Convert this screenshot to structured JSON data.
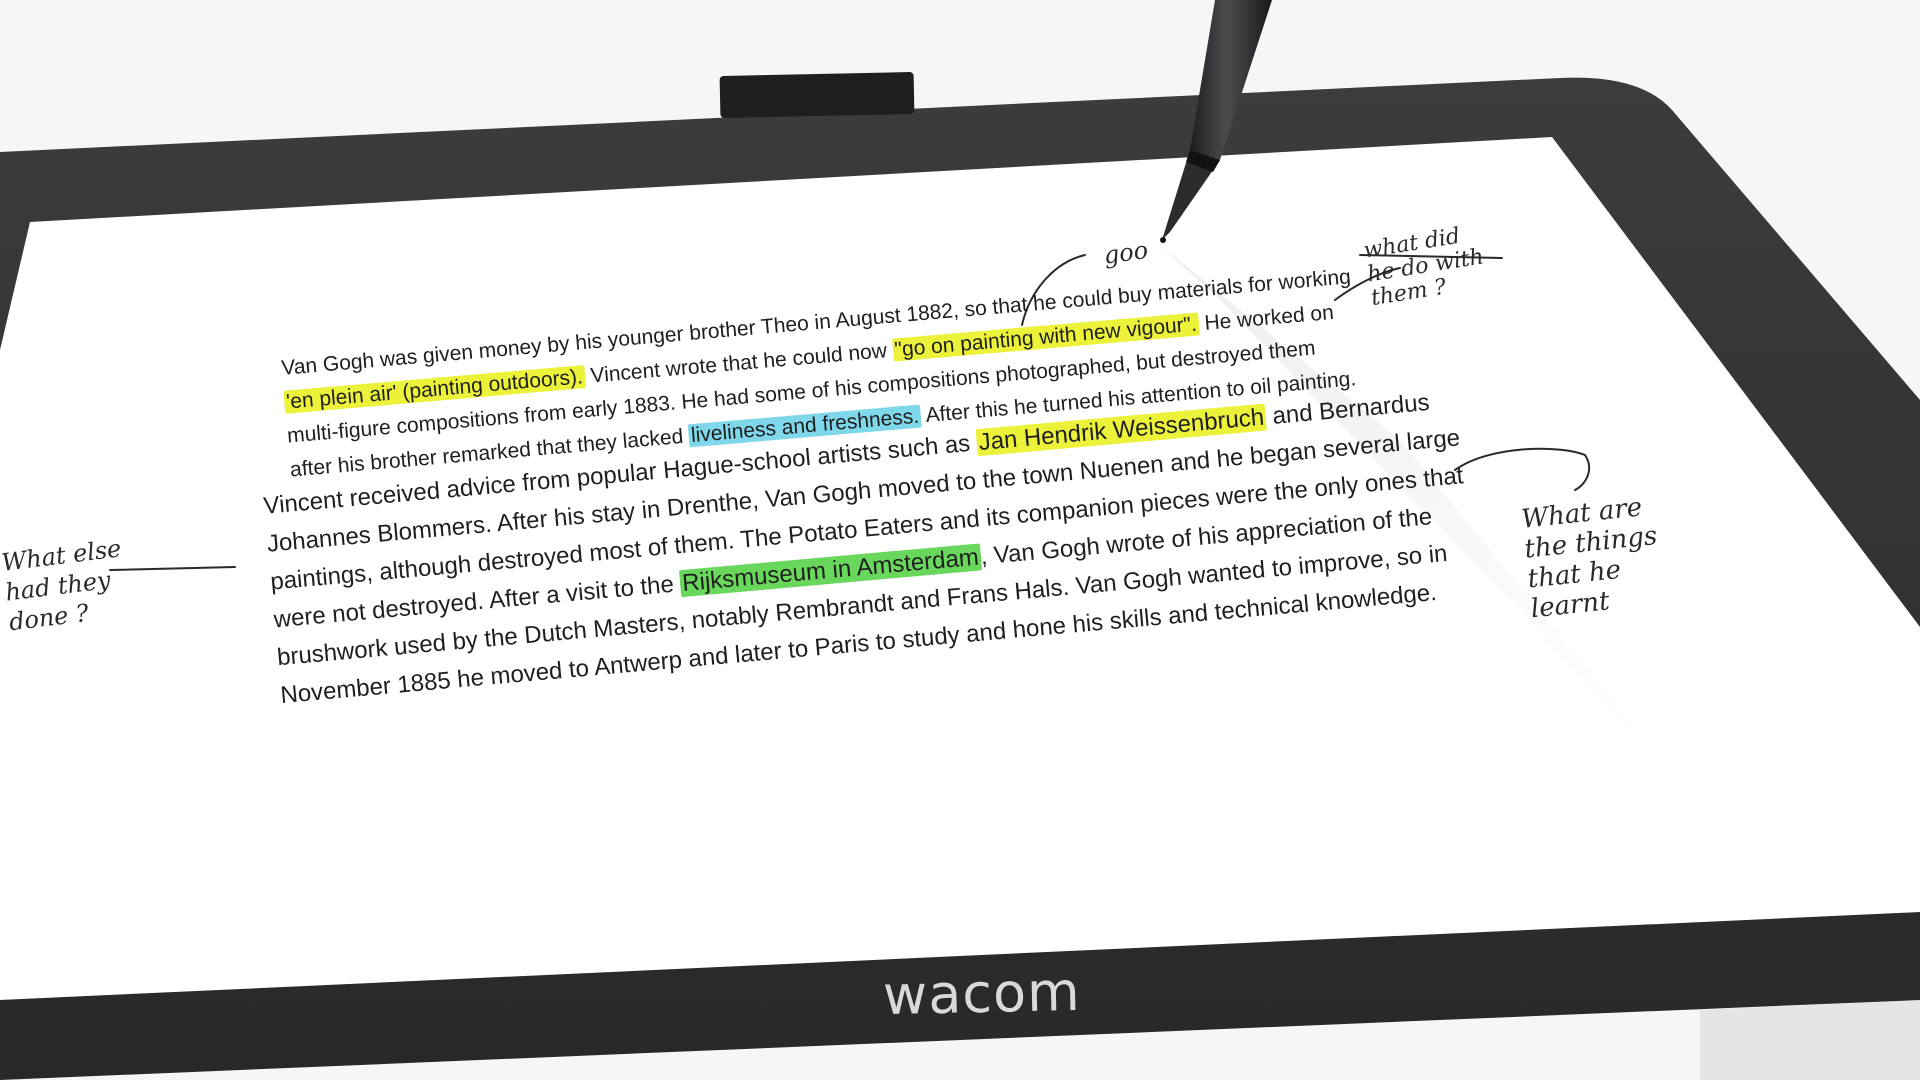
{
  "device": {
    "brand": "wacom",
    "bezel_color": "#2d2f31",
    "screen_color": "#ffffff"
  },
  "document": {
    "paragraph1": {
      "line1": "Van Gogh was given money by his younger brother Theo in August 1882, so that he could buy materials for working",
      "line2_before": "'en plein air' (painting outdoors).",
      "line2_quote": "\"go on painting with new vigour\".",
      "line2_after": " He worked on",
      "line2_mid": " Vincent wrote that he could now ",
      "line3": "multi-figure compositions from early 1883. He had some of his compositions photographed, but destroyed them",
      "line4_before": "after his brother remarked that they lacked ",
      "line4_highlight": "liveliness and freshness.",
      "line4_after": " After this he turned his attention to oil painting."
    },
    "paragraph2": {
      "line1_before": "Vincent received advice from popular Hague-school artists such as ",
      "line1_highlight": "Jan Hendrik Weissenbruch",
      "line1_after": " and Bernardus",
      "line2": "Johannes Blommers. After his stay in Drenthe, Van Gogh moved to the town Nuenen and he began several large",
      "line3": "paintings, although destroyed most of them. The Potato Eaters and its companion pieces were the only ones that",
      "line4_before": "were not destroyed. After a visit to the ",
      "line4_highlight": "Rijksmuseum in Amsterdam",
      "line4_after": ", Van Gogh wrote of his appreciation of the",
      "line5": "brushwork used by the Dutch Masters, notably Rembrandt and Frans Hals. Van Gogh wanted to improve, so in",
      "line6": "November 1885 he moved to Antwerp and later to Paris to study and hone his skills and technical knowledge."
    },
    "highlight_colors": {
      "yellow": "#ecf23a",
      "cyan": "#7fd8ea",
      "green": "#69d75c"
    }
  },
  "annotations": {
    "pen_note": "goo",
    "top_right_note": "what did\nhe do with\nthem ?",
    "left_note": "What else\nhad they\ndone ?",
    "right_note": "What are\nthe things\nthat he\nlearnt"
  }
}
